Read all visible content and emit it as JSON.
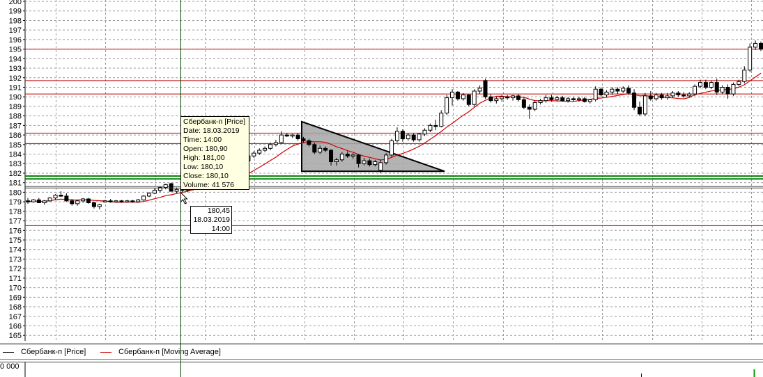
{
  "chart_data": {
    "type": "candlestick",
    "yticks": [
      200,
      199,
      198,
      197,
      196,
      195,
      194,
      193,
      192,
      191,
      190,
      189,
      188,
      187,
      186,
      185,
      184,
      183,
      182,
      181,
      180,
      179,
      178,
      177,
      176,
      175,
      174,
      173,
      172,
      171,
      170,
      169,
      168,
      167,
      166,
      165
    ],
    "series": [
      {
        "name": "Сбербанк-п [Price]",
        "color": "#000000"
      },
      {
        "name": "Сбербанк-п [Moving Average]",
        "color": "#cc0000"
      }
    ],
    "candles": [
      {
        "o": 179.1,
        "h": 179.4,
        "l": 178.8,
        "c": 179.0
      },
      {
        "o": 179.0,
        "h": 179.3,
        "l": 178.9,
        "c": 179.2
      },
      {
        "o": 179.2,
        "h": 179.4,
        "l": 178.9,
        "c": 178.9
      },
      {
        "o": 178.9,
        "h": 179.2,
        "l": 178.7,
        "c": 179.1
      },
      {
        "o": 179.1,
        "h": 179.5,
        "l": 179.0,
        "c": 179.4
      },
      {
        "o": 179.4,
        "h": 179.8,
        "l": 179.2,
        "c": 179.7
      },
      {
        "o": 179.7,
        "h": 180.1,
        "l": 179.5,
        "c": 179.6
      },
      {
        "o": 179.6,
        "h": 179.9,
        "l": 179.0,
        "c": 179.1
      },
      {
        "o": 179.1,
        "h": 179.3,
        "l": 178.6,
        "c": 178.8
      },
      {
        "o": 178.8,
        "h": 179.2,
        "l": 178.6,
        "c": 179.1
      },
      {
        "o": 179.1,
        "h": 179.4,
        "l": 178.9,
        "c": 179.3
      },
      {
        "o": 179.3,
        "h": 179.4,
        "l": 178.8,
        "c": 178.9
      },
      {
        "o": 178.9,
        "h": 179.0,
        "l": 178.3,
        "c": 178.5
      },
      {
        "o": 178.5,
        "h": 178.8,
        "l": 178.2,
        "c": 178.7
      },
      {
        "o": 179.0,
        "h": 179.2,
        "l": 178.9,
        "c": 179.1
      },
      {
        "o": 179.1,
        "h": 179.3,
        "l": 178.9,
        "c": 179.0
      },
      {
        "o": 179.0,
        "h": 179.2,
        "l": 178.9,
        "c": 179.1
      },
      {
        "o": 179.1,
        "h": 179.2,
        "l": 178.9,
        "c": 179.0
      },
      {
        "o": 179.0,
        "h": 179.2,
        "l": 178.9,
        "c": 179.1
      },
      {
        "o": 179.1,
        "h": 179.2,
        "l": 178.9,
        "c": 179.0
      },
      {
        "o": 179.0,
        "h": 179.3,
        "l": 178.9,
        "c": 179.2
      },
      {
        "o": 179.2,
        "h": 179.7,
        "l": 179.1,
        "c": 179.6
      },
      {
        "o": 179.6,
        "h": 180.0,
        "l": 179.5,
        "c": 179.9
      },
      {
        "o": 179.9,
        "h": 180.4,
        "l": 179.8,
        "c": 180.2
      },
      {
        "o": 180.2,
        "h": 180.6,
        "l": 180.0,
        "c": 180.5
      },
      {
        "o": 180.5,
        "h": 180.9,
        "l": 180.3,
        "c": 180.8
      },
      {
        "o": 180.9,
        "h": 181.0,
        "l": 180.1,
        "c": 180.1
      },
      {
        "o": 180.1,
        "h": 180.5,
        "l": 179.9,
        "c": 180.3
      },
      {
        "o": 180.3,
        "h": 180.5,
        "l": 180.0,
        "c": 180.2
      },
      {
        "o": 180.2,
        "h": 180.5,
        "l": 180.0,
        "c": 180.4
      },
      {
        "o": 180.4,
        "h": 180.8,
        "l": 180.2,
        "c": 180.6
      },
      {
        "o": 180.6,
        "h": 181.0,
        "l": 180.4,
        "c": 180.8
      },
      {
        "o": 180.8,
        "h": 181.2,
        "l": 180.6,
        "c": 181.0
      },
      {
        "o": 181.0,
        "h": 181.4,
        "l": 180.8,
        "c": 181.2
      },
      {
        "o": 181.2,
        "h": 181.6,
        "l": 181.0,
        "c": 181.4
      },
      {
        "o": 181.4,
        "h": 181.9,
        "l": 181.2,
        "c": 181.7
      },
      {
        "o": 182.2,
        "h": 182.4,
        "l": 181.6,
        "c": 181.7
      },
      {
        "o": 181.7,
        "h": 182.2,
        "l": 181.6,
        "c": 182.1
      },
      {
        "o": 182.1,
        "h": 182.7,
        "l": 181.9,
        "c": 182.5
      },
      {
        "o": 182.5,
        "h": 183.5,
        "l": 182.3,
        "c": 183.3
      },
      {
        "o": 183.3,
        "h": 184.0,
        "l": 183.1,
        "c": 183.8
      },
      {
        "o": 183.8,
        "h": 184.3,
        "l": 183.6,
        "c": 184.1
      },
      {
        "o": 184.1,
        "h": 184.6,
        "l": 183.9,
        "c": 184.4
      },
      {
        "o": 184.4,
        "h": 184.8,
        "l": 184.2,
        "c": 184.6
      },
      {
        "o": 184.6,
        "h": 185.2,
        "l": 184.4,
        "c": 185.0
      },
      {
        "o": 185.0,
        "h": 185.5,
        "l": 184.8,
        "c": 185.2
      },
      {
        "o": 185.2,
        "h": 186.4,
        "l": 185.1,
        "c": 186.0
      },
      {
        "o": 186.0,
        "h": 186.2,
        "l": 185.8,
        "c": 185.9
      },
      {
        "o": 185.9,
        "h": 186.1,
        "l": 185.7,
        "c": 186.0
      },
      {
        "o": 186.0,
        "h": 186.2,
        "l": 185.4,
        "c": 185.6
      },
      {
        "o": 185.6,
        "h": 185.8,
        "l": 185.2,
        "c": 185.4
      },
      {
        "o": 185.4,
        "h": 185.6,
        "l": 184.8,
        "c": 185.0
      },
      {
        "o": 185.0,
        "h": 185.2,
        "l": 184.0,
        "c": 184.2
      },
      {
        "o": 184.2,
        "h": 184.9,
        "l": 184.0,
        "c": 184.6
      },
      {
        "o": 184.6,
        "h": 184.8,
        "l": 184.2,
        "c": 184.4
      },
      {
        "o": 184.4,
        "h": 184.5,
        "l": 182.8,
        "c": 183.2
      },
      {
        "o": 183.2,
        "h": 183.6,
        "l": 182.8,
        "c": 183.4
      },
      {
        "o": 183.4,
        "h": 184.2,
        "l": 183.2,
        "c": 184.0
      },
      {
        "o": 184.0,
        "h": 184.3,
        "l": 183.6,
        "c": 183.8
      },
      {
        "o": 183.8,
        "h": 184.1,
        "l": 183.5,
        "c": 183.9
      },
      {
        "o": 183.9,
        "h": 184.0,
        "l": 182.6,
        "c": 183.0
      },
      {
        "o": 183.0,
        "h": 183.6,
        "l": 182.8,
        "c": 183.3
      },
      {
        "o": 183.3,
        "h": 183.5,
        "l": 182.7,
        "c": 182.9
      },
      {
        "o": 182.9,
        "h": 183.4,
        "l": 182.7,
        "c": 183.2
      },
      {
        "o": 182.3,
        "h": 183.4,
        "l": 182.0,
        "c": 183.1
      },
      {
        "o": 183.1,
        "h": 184.1,
        "l": 182.9,
        "c": 183.9
      },
      {
        "o": 183.9,
        "h": 185.6,
        "l": 183.7,
        "c": 185.4
      },
      {
        "o": 185.4,
        "h": 186.8,
        "l": 185.2,
        "c": 186.4
      },
      {
        "o": 186.4,
        "h": 186.6,
        "l": 185.3,
        "c": 185.6
      },
      {
        "o": 185.6,
        "h": 186.2,
        "l": 185.4,
        "c": 186.0
      },
      {
        "o": 186.0,
        "h": 186.2,
        "l": 185.3,
        "c": 185.5
      },
      {
        "o": 185.5,
        "h": 186.2,
        "l": 185.3,
        "c": 186.1
      },
      {
        "o": 186.1,
        "h": 186.7,
        "l": 185.9,
        "c": 186.5
      },
      {
        "o": 186.5,
        "h": 187.2,
        "l": 186.3,
        "c": 187.0
      },
      {
        "o": 187.0,
        "h": 187.6,
        "l": 186.5,
        "c": 186.9
      },
      {
        "o": 186.9,
        "h": 188.6,
        "l": 186.8,
        "c": 188.3
      },
      {
        "o": 188.3,
        "h": 190.2,
        "l": 188.1,
        "c": 189.9
      },
      {
        "o": 189.9,
        "h": 190.8,
        "l": 189.1,
        "c": 190.5
      },
      {
        "o": 190.5,
        "h": 190.6,
        "l": 189.6,
        "c": 189.8
      },
      {
        "o": 189.8,
        "h": 190.4,
        "l": 189.6,
        "c": 190.2
      },
      {
        "o": 190.2,
        "h": 190.3,
        "l": 189.0,
        "c": 189.2
      },
      {
        "o": 189.2,
        "h": 190.8,
        "l": 189.0,
        "c": 190.6
      },
      {
        "o": 190.6,
        "h": 191.2,
        "l": 190.3,
        "c": 190.9
      },
      {
        "o": 191.7,
        "h": 191.9,
        "l": 189.8,
        "c": 190.0
      },
      {
        "o": 190.0,
        "h": 190.3,
        "l": 189.4,
        "c": 189.6
      },
      {
        "o": 189.6,
        "h": 190.0,
        "l": 189.3,
        "c": 189.8
      },
      {
        "o": 189.8,
        "h": 190.2,
        "l": 189.5,
        "c": 190.0
      },
      {
        "o": 190.0,
        "h": 190.2,
        "l": 189.7,
        "c": 189.9
      },
      {
        "o": 189.9,
        "h": 190.2,
        "l": 189.6,
        "c": 190.1
      },
      {
        "o": 190.1,
        "h": 190.3,
        "l": 189.5,
        "c": 189.7
      },
      {
        "o": 189.7,
        "h": 189.9,
        "l": 188.7,
        "c": 188.9
      },
      {
        "o": 188.9,
        "h": 189.2,
        "l": 187.7,
        "c": 188.7
      },
      {
        "o": 188.7,
        "h": 189.6,
        "l": 188.5,
        "c": 189.4
      },
      {
        "o": 189.4,
        "h": 189.8,
        "l": 189.2,
        "c": 189.6
      },
      {
        "o": 189.6,
        "h": 190.2,
        "l": 189.4,
        "c": 189.9
      },
      {
        "o": 189.9,
        "h": 190.2,
        "l": 189.5,
        "c": 189.7
      },
      {
        "o": 189.7,
        "h": 190.1,
        "l": 189.5,
        "c": 189.9
      },
      {
        "o": 189.9,
        "h": 190.1,
        "l": 189.5,
        "c": 189.6
      },
      {
        "o": 189.6,
        "h": 190.0,
        "l": 189.4,
        "c": 189.8
      },
      {
        "o": 189.8,
        "h": 190.0,
        "l": 189.5,
        "c": 189.7
      },
      {
        "o": 189.7,
        "h": 190.0,
        "l": 189.5,
        "c": 189.8
      },
      {
        "o": 189.8,
        "h": 190.0,
        "l": 189.4,
        "c": 189.5
      },
      {
        "o": 189.5,
        "h": 189.8,
        "l": 189.3,
        "c": 189.7
      },
      {
        "o": 189.7,
        "h": 191.1,
        "l": 189.5,
        "c": 190.8
      },
      {
        "o": 190.8,
        "h": 191.0,
        "l": 190.0,
        "c": 190.2
      },
      {
        "o": 190.2,
        "h": 190.7,
        "l": 190.0,
        "c": 190.5
      },
      {
        "o": 190.5,
        "h": 191.0,
        "l": 190.2,
        "c": 190.8
      },
      {
        "o": 190.8,
        "h": 191.0,
        "l": 190.3,
        "c": 190.6
      },
      {
        "o": 190.6,
        "h": 191.1,
        "l": 190.4,
        "c": 190.9
      },
      {
        "o": 190.9,
        "h": 191.2,
        "l": 190.2,
        "c": 190.4
      },
      {
        "o": 190.4,
        "h": 190.8,
        "l": 188.6,
        "c": 188.9
      },
      {
        "o": 188.9,
        "h": 189.5,
        "l": 188.0,
        "c": 188.2
      },
      {
        "o": 188.2,
        "h": 190.4,
        "l": 188.0,
        "c": 190.1
      },
      {
        "o": 190.1,
        "h": 190.6,
        "l": 189.6,
        "c": 189.8
      },
      {
        "o": 189.8,
        "h": 190.4,
        "l": 189.6,
        "c": 190.2
      },
      {
        "o": 190.2,
        "h": 190.4,
        "l": 189.7,
        "c": 189.9
      },
      {
        "o": 189.9,
        "h": 190.4,
        "l": 189.7,
        "c": 190.1
      },
      {
        "o": 190.1,
        "h": 190.6,
        "l": 189.9,
        "c": 190.4
      },
      {
        "o": 190.4,
        "h": 190.6,
        "l": 190.0,
        "c": 190.2
      },
      {
        "o": 190.2,
        "h": 190.5,
        "l": 189.9,
        "c": 190.1
      },
      {
        "o": 190.1,
        "h": 190.5,
        "l": 189.9,
        "c": 190.3
      },
      {
        "o": 190.3,
        "h": 191.3,
        "l": 190.1,
        "c": 191.1
      },
      {
        "o": 191.1,
        "h": 191.8,
        "l": 190.9,
        "c": 191.5
      },
      {
        "o": 191.5,
        "h": 191.8,
        "l": 190.8,
        "c": 191.0
      },
      {
        "o": 191.0,
        "h": 191.7,
        "l": 190.8,
        "c": 191.5
      },
      {
        "o": 191.5,
        "h": 191.9,
        "l": 190.2,
        "c": 190.5
      },
      {
        "o": 190.5,
        "h": 191.2,
        "l": 190.3,
        "c": 191.0
      },
      {
        "o": 191.0,
        "h": 191.3,
        "l": 189.8,
        "c": 190.3
      },
      {
        "o": 190.3,
        "h": 191.5,
        "l": 190.1,
        "c": 191.3
      },
      {
        "o": 191.3,
        "h": 191.8,
        "l": 191.1,
        "c": 191.6
      },
      {
        "o": 191.6,
        "h": 193.2,
        "l": 191.4,
        "c": 192.8
      },
      {
        "o": 192.8,
        "h": 195.6,
        "l": 192.6,
        "c": 195.2
      },
      {
        "o": 195.2,
        "h": 195.9,
        "l": 194.9,
        "c": 195.6
      },
      {
        "o": 195.6,
        "h": 195.8,
        "l": 194.8,
        "c": 195.0
      }
    ],
    "horizontal_levels": {
      "red": [
        195.0,
        191.7,
        190.3,
        186.2,
        185.1,
        176.5
      ],
      "green": [
        181.7,
        181.4
      ],
      "gray": [
        180.6
      ]
    },
    "triangle": {
      "apex_price": 187.4,
      "top_price": 187.4,
      "bottom_price": 182.2,
      "end_price": 182.2
    },
    "crosshair": {
      "price": 180.45,
      "date": "18.03.2019",
      "time": "14:00"
    },
    "tooltip": {
      "title": "Сбербанк-п [Price]",
      "date": "Date: 18.03.2019",
      "time": "Time: 14:00",
      "open": "Open:  180,90",
      "high": "High:  181,00",
      "low": "Low:  180,10",
      "close": "Close: 180,10",
      "volume": "Volume: 41 576"
    },
    "crosshair_label": {
      "price": "180,45",
      "date": "18.03.2019",
      "time": "14:00"
    },
    "volume_axis_label": "0 000"
  },
  "legend": {
    "price": "Сбербанк-п [Price]",
    "ma": "Сбербанк-п [Moving Average]"
  }
}
